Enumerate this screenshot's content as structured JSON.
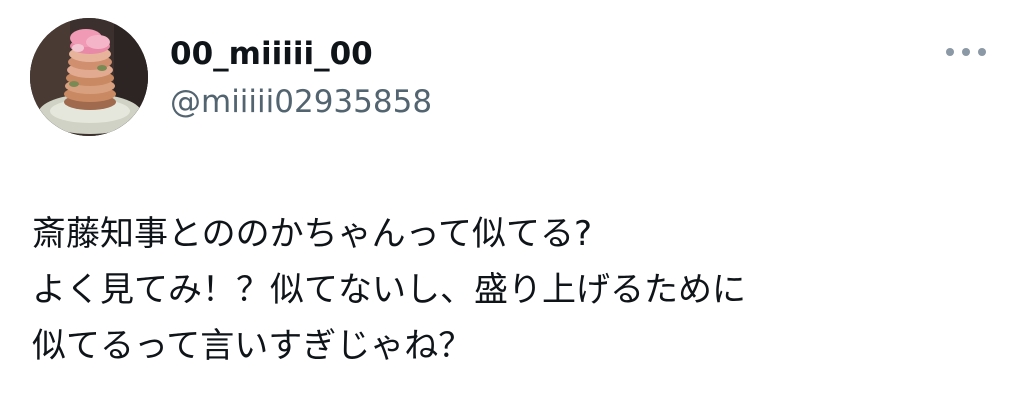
{
  "tweet": {
    "display_name": "00_miiiii_00",
    "handle": "@miiiii02935858",
    "more_icon": "more-horizontal-icon",
    "avatar_icon": "avatar-photo-icon",
    "lines": [
      "斎藤知事とののかちゃんって似てる?",
      "よく見てみ！？似てないし、盛り上げるために",
      "似てるって言いすぎじゃね？"
    ]
  },
  "colors": {
    "text": "#0f1419",
    "secondary": "#536471",
    "more_dots": "#8b98a5",
    "background": "#ffffff"
  }
}
